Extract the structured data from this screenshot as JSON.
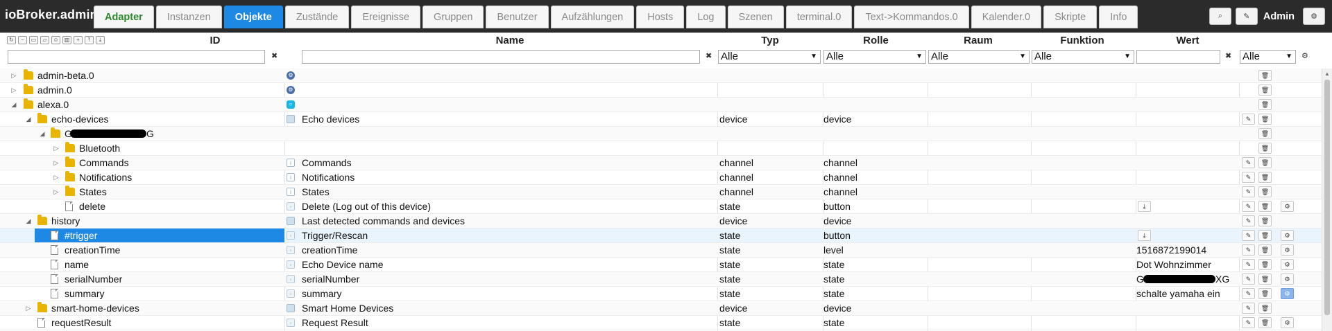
{
  "app": {
    "title": "ioBroker.admin",
    "user": "Admin"
  },
  "tabs": [
    {
      "label": "Adapter"
    },
    {
      "label": "Instanzen"
    },
    {
      "label": "Objekte"
    },
    {
      "label": "Zustände"
    },
    {
      "label": "Ereignisse"
    },
    {
      "label": "Gruppen"
    },
    {
      "label": "Benutzer"
    },
    {
      "label": "Aufzählungen"
    },
    {
      "label": "Hosts"
    },
    {
      "label": "Log"
    },
    {
      "label": "Szenen"
    },
    {
      "label": "terminal.0"
    },
    {
      "label": "Text->Kommandos.0"
    },
    {
      "label": "Kalender.0"
    },
    {
      "label": "Skripte"
    },
    {
      "label": "Info"
    }
  ],
  "active_tab": "Objekte",
  "columns": {
    "id": "ID",
    "name": "Name",
    "typ": "Typ",
    "rolle": "Rolle",
    "raum": "Raum",
    "funktion": "Funktion",
    "wert": "Wert"
  },
  "filters": {
    "typ": "Alle",
    "rolle": "Alle",
    "raum": "Alle",
    "funktion": "Alle",
    "extra": "Alle"
  },
  "rows": [
    {
      "label": "admin-beta.0",
      "name": "",
      "typ": "",
      "rolle": "",
      "wert": ""
    },
    {
      "label": "admin.0",
      "name": "",
      "typ": "",
      "rolle": "",
      "wert": ""
    },
    {
      "label": "alexa.0",
      "name": "",
      "typ": "",
      "rolle": "",
      "wert": ""
    },
    {
      "label": "echo-devices",
      "name": "Echo devices",
      "typ": "device",
      "rolle": "device",
      "wert": ""
    },
    {
      "label": "G",
      "label_suffix": "G",
      "name": "",
      "typ": "",
      "rolle": "",
      "wert": ""
    },
    {
      "label": "Bluetooth",
      "name": "",
      "typ": "",
      "rolle": "",
      "wert": ""
    },
    {
      "label": "Commands",
      "name": "Commands",
      "typ": "channel",
      "rolle": "channel",
      "wert": ""
    },
    {
      "label": "Notifications",
      "name": "Notifications",
      "typ": "channel",
      "rolle": "channel",
      "wert": ""
    },
    {
      "label": "States",
      "name": "States",
      "typ": "channel",
      "rolle": "channel",
      "wert": ""
    },
    {
      "label": "delete",
      "name": "Delete (Log out of this device)",
      "typ": "state",
      "rolle": "button",
      "wert": ""
    },
    {
      "label": "history",
      "name": "Last detected commands and devices",
      "typ": "device",
      "rolle": "device",
      "wert": ""
    },
    {
      "label": "#trigger",
      "name": "Trigger/Rescan",
      "typ": "state",
      "rolle": "button",
      "wert": ""
    },
    {
      "label": "creationTime",
      "name": "creationTime",
      "typ": "state",
      "rolle": "level",
      "wert": "1516872199014"
    },
    {
      "label": "name",
      "name": "Echo Device name",
      "typ": "state",
      "rolle": "state",
      "wert": "Dot Wohnzimmer"
    },
    {
      "label": "serialNumber",
      "name": "serialNumber",
      "typ": "state",
      "rolle": "state",
      "wert": "G",
      "wert_suffix": "XG"
    },
    {
      "label": "summary",
      "name": "summary",
      "typ": "state",
      "rolle": "state",
      "wert": "schalte yamaha ein"
    },
    {
      "label": "smart-home-devices",
      "name": "Smart Home Devices",
      "typ": "device",
      "rolle": "device",
      "wert": ""
    },
    {
      "label": "requestResult",
      "name": "Request Result",
      "typ": "state",
      "rolle": "state",
      "wert": ""
    }
  ]
}
